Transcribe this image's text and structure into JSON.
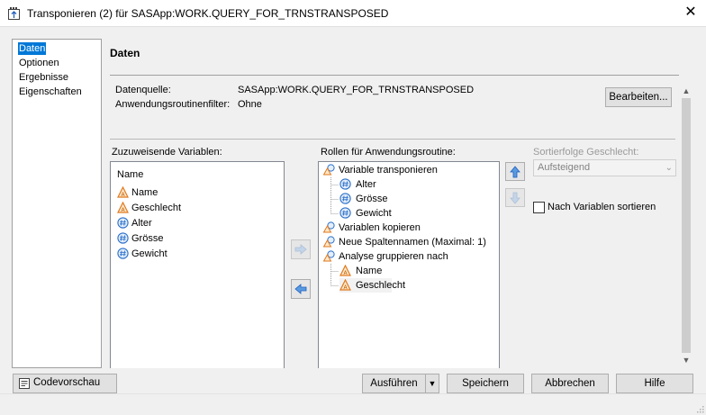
{
  "window": {
    "title": "Transponieren (2) für SASApp:WORK.QUERY_FOR_TRNSTRANSPOSED"
  },
  "nav": {
    "items": [
      "Daten",
      "Optionen",
      "Ergebnisse",
      "Eigenschaften"
    ],
    "selected": "Daten"
  },
  "page": {
    "title": "Daten",
    "datasource_label": "Datenquelle:",
    "datasource_value": "SASApp:WORK.QUERY_FOR_TRNSTRANSPOSED",
    "filter_label": "Anwendungsroutinenfilter:",
    "filter_value": "Ohne",
    "edit_button": "Bearbeiten..."
  },
  "available_variables": {
    "label": "Zuzuweisende Variablen:",
    "header": "Name",
    "items": [
      {
        "name": "Name",
        "type": "character"
      },
      {
        "name": "Geschlecht",
        "type": "character"
      },
      {
        "name": "Alter",
        "type": "numeric"
      },
      {
        "name": "Grösse",
        "type": "numeric"
      },
      {
        "name": "Gewicht",
        "type": "numeric"
      }
    ]
  },
  "roles": {
    "label": "Rollen für Anwendungsroutine:",
    "groups": [
      {
        "label": "Variable transponieren",
        "children": [
          "Alter",
          "Grösse",
          "Gewicht"
        ]
      },
      {
        "label": "Variablen kopieren",
        "children": []
      },
      {
        "label": "Neue Spaltennamen  (Maximal: 1)",
        "children": []
      },
      {
        "label": "Analyse gruppieren nach",
        "children": [
          "Name",
          "Geschlecht"
        ]
      }
    ]
  },
  "sort": {
    "label": "Sortierfolge Geschlecht:",
    "value": "Aufsteigend",
    "checkbox_label": "Nach Variablen sortieren",
    "checked": false
  },
  "footer": {
    "preview": "Codevorschau",
    "run": "Ausführen",
    "save": "Speichern",
    "cancel": "Abbrechen",
    "help": "Hilfe"
  },
  "colors": {
    "selection": "#0078d7",
    "character_icon": "#e07a1f",
    "numeric_icon": "#2a6fc9"
  }
}
